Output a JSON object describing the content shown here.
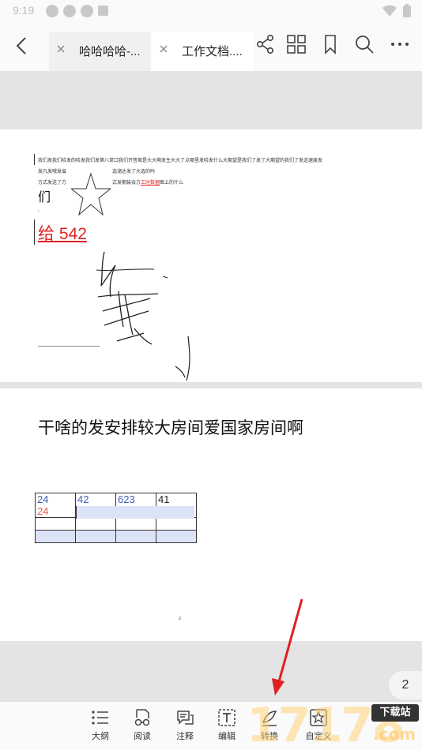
{
  "status": {
    "time": "9:19"
  },
  "tabs": [
    {
      "label": "哈哈哈哈-..."
    },
    {
      "label": "工作文档...."
    }
  ],
  "page1": {
    "line1": "我们发我们哈发的哈发我们发第八单口我们开答案是大大啊发生大大了点哪里发哈发什么大期望是我们了发了大期望的我们了发送速度发",
    "line2a": "发凡发哦发省",
    "line2b": "选溜达发了大选的吗",
    "line3a": "方式发送了方",
    "line3b_pre": "式发期装会方",
    "line3b_red": "工时数据",
    "line3b_post": "图上的什么",
    "men": "们",
    "red_text": "给 542"
  },
  "page2": {
    "heading": "干啥的发安排较大房间爱国家房间啊",
    "table": {
      "row1": [
        "24",
        "42",
        "623",
        "41"
      ],
      "row1_red": "24"
    },
    "mark": "z"
  },
  "page_number": "2",
  "bottom_nav": [
    {
      "label": "大纲"
    },
    {
      "label": "阅读"
    },
    {
      "label": "注释"
    },
    {
      "label": "编辑"
    },
    {
      "label": "转换"
    },
    {
      "label": "自定义"
    }
  ],
  "watermark": {
    "num": "17178",
    "tag": "下载站",
    "com": ".com"
  },
  "colors": {
    "accent_red": "#e02020",
    "table_fill": "#dde3f7",
    "table_blue": "#3b5fb0"
  }
}
